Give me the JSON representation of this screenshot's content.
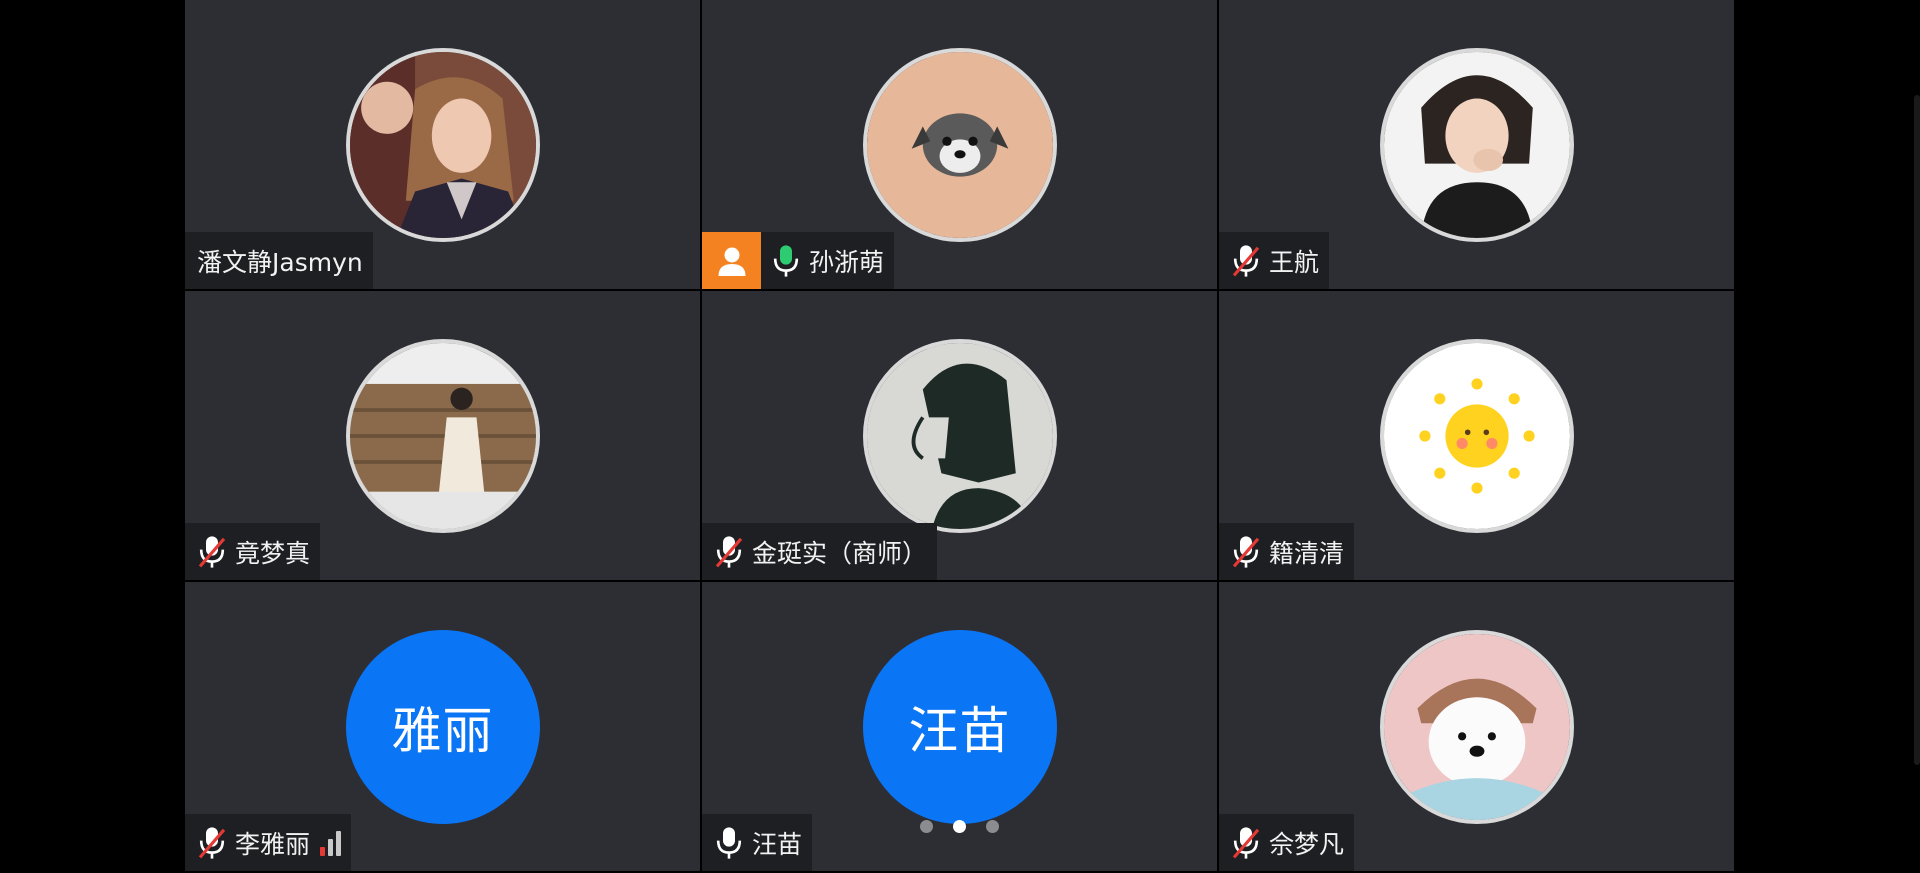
{
  "tiles": [
    {
      "name": "潘文静Jasmyn",
      "mic": "none",
      "avatar": "photo"
    },
    {
      "name": "孙浙萌",
      "mic": "on",
      "avatar": "photo",
      "host": true
    },
    {
      "name": "王航",
      "mic": "muted",
      "avatar": "photo"
    },
    {
      "name": "竟梦真",
      "mic": "muted",
      "avatar": "photo"
    },
    {
      "name": "金珽实（商师）",
      "mic": "muted",
      "avatar": "photo"
    },
    {
      "name": "籍清清",
      "mic": "muted",
      "avatar": "photo"
    },
    {
      "name": "李雅丽",
      "mic": "muted",
      "avatar": "initials",
      "initials": "雅丽",
      "signal_strength": 1
    },
    {
      "name": "汪苗",
      "mic": "on",
      "avatar": "initials",
      "initials": "汪苗"
    },
    {
      "name": "佘梦凡",
      "mic": "muted",
      "avatar": "photo"
    }
  ],
  "pagination": {
    "total": 3,
    "current": 2
  },
  "colors": {
    "tile_bg": "#2c2e33",
    "initials_avatar": "#0a75f5",
    "host_badge": "#f58220",
    "mic_active": "#2ecc71",
    "mic_muted_slash": "#e53935",
    "signal_good": "#e53935",
    "signal_empty": "#c9c9c9"
  },
  "icons": {
    "mic": "microphone-icon",
    "mic_muted": "microphone-muted-icon",
    "host": "person-icon",
    "signal": "signal-strength-icon"
  }
}
